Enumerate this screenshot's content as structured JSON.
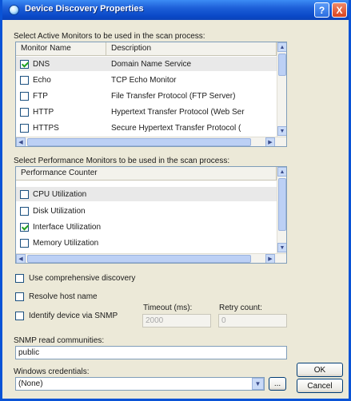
{
  "window": {
    "title": "Device Discovery Properties",
    "help_button": "?",
    "close_button": "X"
  },
  "active_monitors": {
    "section_label": "Select Active Monitors to be used in the scan process:",
    "columns": [
      "Monitor Name",
      "Description"
    ],
    "rows": [
      {
        "name": "DNS",
        "description": "Domain Name Service",
        "checked": true
      },
      {
        "name": "Echo",
        "description": "TCP Echo Monitor",
        "checked": false
      },
      {
        "name": "FTP",
        "description": "File Transfer Protocol (FTP Server)",
        "checked": false
      },
      {
        "name": "HTTP",
        "description": "Hypertext Transfer Protocol (Web Ser",
        "checked": false
      },
      {
        "name": "HTTPS",
        "description": "Secure Hypertext Transfer Protocol (",
        "checked": false
      }
    ]
  },
  "performance_monitors": {
    "section_label": "Select Performance Monitors to be used in the scan process:",
    "columns": [
      "Performance Counter"
    ],
    "rows": [
      {
        "name": "CPU Utilization",
        "checked": false
      },
      {
        "name": "Disk Utilization",
        "checked": false
      },
      {
        "name": "Interface Utilization",
        "checked": true
      },
      {
        "name": "Memory Utilization",
        "checked": false
      }
    ]
  },
  "options": {
    "comprehensive": "Use comprehensive discovery",
    "resolve": "Resolve host name",
    "identify_snmp": "Identify device via SNMP",
    "timeout_label": "Timeout (ms):",
    "timeout_value": "2000",
    "retry_label": "Retry count:",
    "retry_value": "0"
  },
  "snmp": {
    "label": "SNMP read communities:",
    "value": "public"
  },
  "credentials": {
    "label": "Windows credentials:",
    "value": "(None)",
    "browse_button": "..."
  },
  "buttons": {
    "ok": "OK",
    "cancel": "Cancel"
  },
  "icons": {
    "dropdown": "chevron-down-icon",
    "scroll_up": "arrow-up-icon",
    "scroll_down": "arrow-down-icon",
    "scroll_left": "arrow-left-icon",
    "scroll_right": "arrow-right-icon"
  },
  "colors": {
    "title_bar": "#0a49c8",
    "dialog_bg": "#ece9d8",
    "check": "#21a121"
  }
}
